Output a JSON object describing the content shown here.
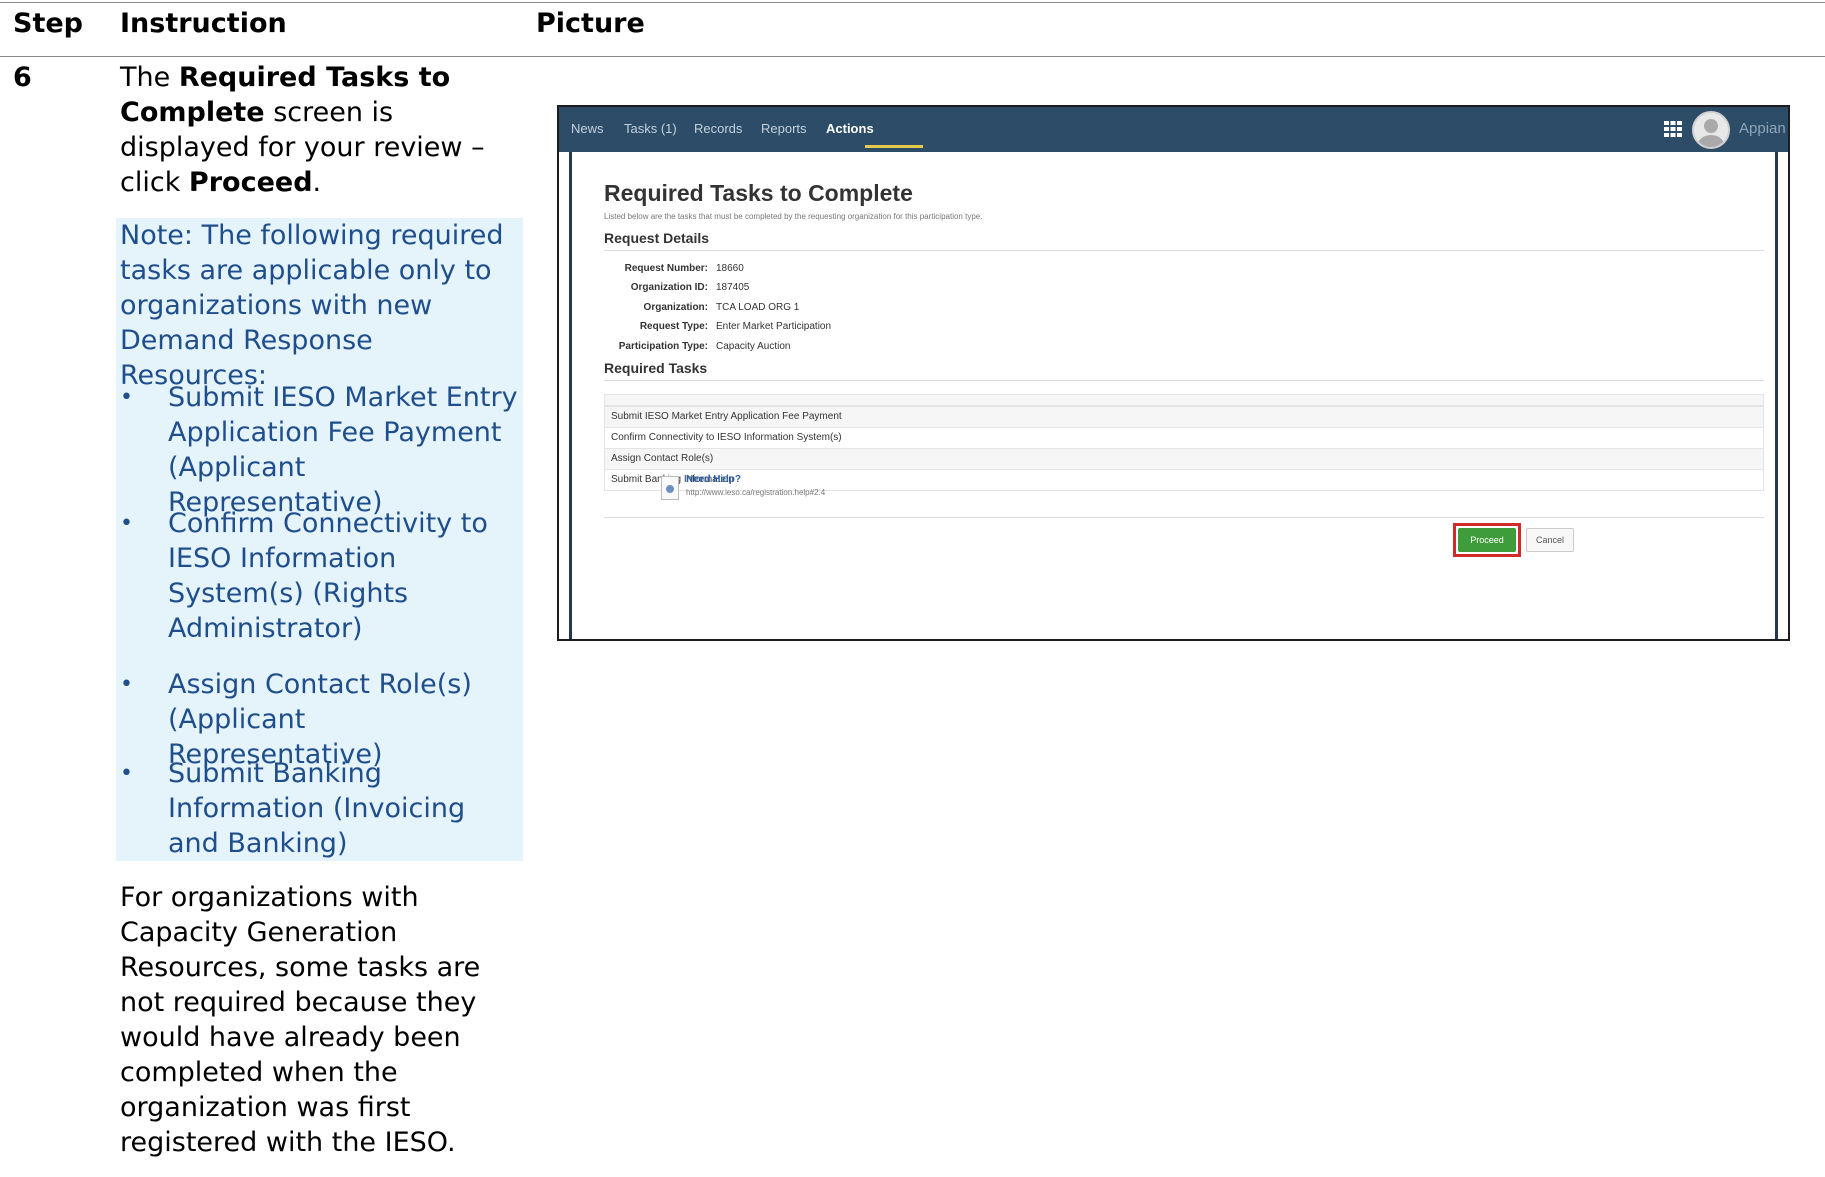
{
  "table": {
    "headers": {
      "step": "Step",
      "instruction": "Instruction",
      "picture": "Picture"
    },
    "row": {
      "step": "6",
      "instruction": {
        "prefix": "The ",
        "screen_name": "Required Tasks to Complete",
        "middle": " screen is displayed for your review – click ",
        "action": "Proceed",
        "suffix": "."
      },
      "note": {
        "intro": "Note: The following required tasks are applicable only to organizations with new Demand Response Resources:",
        "bullets": [
          "Submit IESO Market Entry Application Fee Payment (Applicant Representative)",
          "Confirm Connectivity to IESO Information System(s) (Rights Administrator)",
          "Assign Contact Role(s) (Applicant Representative)",
          "Submit Banking Information (Invoicing and Banking)"
        ]
      },
      "paragraph": "For organizations with Capacity Generation Resources, some tasks are not required because they would have already been completed when the organization was first registered with the IESO."
    }
  },
  "screenshot": {
    "nav": {
      "tabs": [
        "News",
        "Tasks (1)",
        "Records",
        "Reports",
        "Actions"
      ],
      "active_tab": "Actions",
      "brand": "Appian",
      "icons": [
        "apps-grid-icon",
        "user-avatar-icon"
      ]
    },
    "title": "Required Tasks to Complete",
    "subtitle": "Listed below are the tasks that must be completed by the requesting organization for this participation type.",
    "request_details": {
      "heading": "Request Details",
      "fields": [
        {
          "label": "Request Number:",
          "value": "18660"
        },
        {
          "label": "Organization ID:",
          "value": "187405"
        },
        {
          "label": "Organization:",
          "value": "TCA LOAD ORG 1"
        },
        {
          "label": "Request Type:",
          "value": "Enter Market Participation"
        },
        {
          "label": "Participation Type:",
          "value": "Capacity Auction"
        }
      ]
    },
    "required_tasks": {
      "heading": "Required Tasks",
      "tasks": [
        "Submit IESO Market Entry Application Fee Payment",
        "Confirm Connectivity to IESO Information System(s)",
        "Assign Contact Role(s)",
        "Submit Banking Information"
      ]
    },
    "help": {
      "label": "Need Help?",
      "url": "http://www.ieso.ca/registration.help#2.4"
    },
    "buttons": {
      "proceed": "Proceed",
      "cancel": "Cancel"
    },
    "colors": {
      "nav_bg": "#2c4c68",
      "proceed_bg": "#3f9c3a",
      "highlight": "#d12a2a"
    }
  }
}
